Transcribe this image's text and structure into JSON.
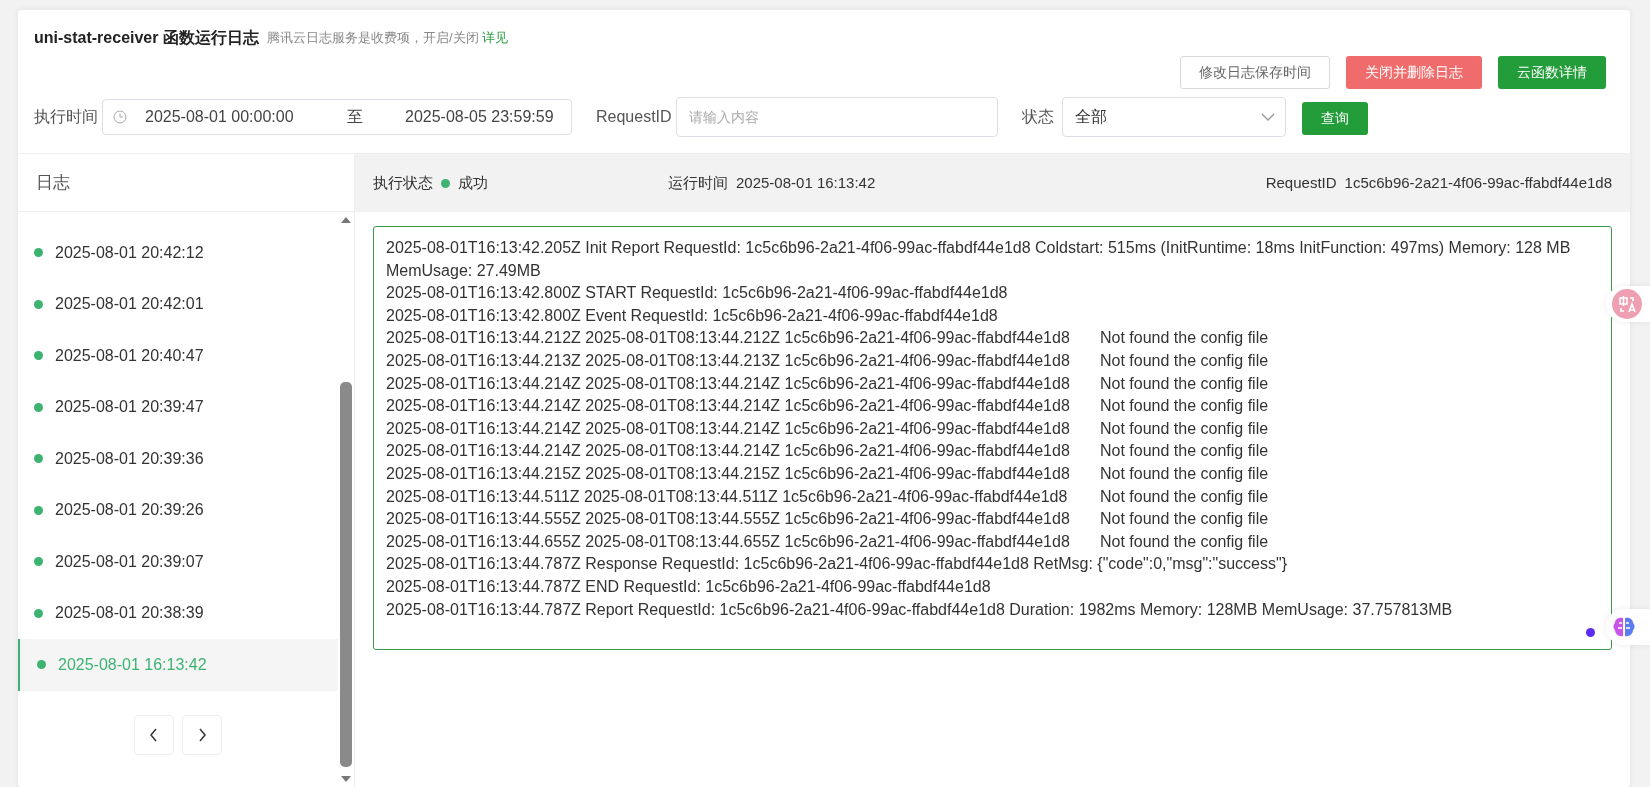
{
  "header": {
    "title": "uni-stat-receiver 函数运行日志",
    "note": "腾讯云日志服务是收费项，开启/关闭",
    "note_link": "详见"
  },
  "actions": [
    {
      "label": "修改日志保存时间",
      "kind": "outline"
    },
    {
      "label": "关闭并删除日志",
      "kind": "danger"
    },
    {
      "label": "云函数详情",
      "kind": "primary"
    }
  ],
  "filters": {
    "time_label": "执行时间",
    "start": "2025-08-01 00:00:00",
    "separator": "至",
    "end": "2025-08-05 23:59:59",
    "request_label": "RequestID",
    "request_placeholder": "请输入内容",
    "status_label": "状态",
    "status_value": "全部",
    "query_button": "查询"
  },
  "sidebar": {
    "title": "日志",
    "items": [
      {
        "time": "2025-08-01 20:42:12",
        "selected": false
      },
      {
        "time": "2025-08-01 20:42:01",
        "selected": false
      },
      {
        "time": "2025-08-01 20:40:47",
        "selected": false
      },
      {
        "time": "2025-08-01 20:39:47",
        "selected": false
      },
      {
        "time": "2025-08-01 20:39:36",
        "selected": false
      },
      {
        "time": "2025-08-01 20:39:26",
        "selected": false
      },
      {
        "time": "2025-08-01 20:39:07",
        "selected": false
      },
      {
        "time": "2025-08-01 20:38:39",
        "selected": false
      },
      {
        "time": "2025-08-01 16:13:42",
        "selected": true
      }
    ]
  },
  "detail": {
    "status_label": "执行状态",
    "status": "成功",
    "runtime_label": "运行时间",
    "runtime": "2025-08-01 16:13:42",
    "request_label": "RequestID",
    "request_id": "1c5c6b96-2a21-4f06-99ac-ffabdf44e1d8",
    "log_lines": [
      "2025-08-01T16:13:42.205Z Init Report RequestId: 1c5c6b96-2a21-4f06-99ac-ffabdf44e1d8 Coldstart: 515ms (InitRuntime: 18ms InitFunction: 497ms) Memory: 128 MB MemUsage: 27.49MB",
      "2025-08-01T16:13:42.800Z START RequestId: 1c5c6b96-2a21-4f06-99ac-ffabdf44e1d8",
      "2025-08-01T16:13:42.800Z Event RequestId: 1c5c6b96-2a21-4f06-99ac-ffabdf44e1d8",
      "2025-08-01T16:13:44.212Z 2025-08-01T08:13:44.212Z 1c5c6b96-2a21-4f06-99ac-ffabdf44e1d8\tNot found the config file",
      "2025-08-01T16:13:44.213Z 2025-08-01T08:13:44.213Z 1c5c6b96-2a21-4f06-99ac-ffabdf44e1d8\tNot found the config file",
      "2025-08-01T16:13:44.214Z 2025-08-01T08:13:44.214Z 1c5c6b96-2a21-4f06-99ac-ffabdf44e1d8\tNot found the config file",
      "2025-08-01T16:13:44.214Z 2025-08-01T08:13:44.214Z 1c5c6b96-2a21-4f06-99ac-ffabdf44e1d8\tNot found the config file",
      "2025-08-01T16:13:44.214Z 2025-08-01T08:13:44.214Z 1c5c6b96-2a21-4f06-99ac-ffabdf44e1d8\tNot found the config file",
      "2025-08-01T16:13:44.214Z 2025-08-01T08:13:44.214Z 1c5c6b96-2a21-4f06-99ac-ffabdf44e1d8\tNot found the config file",
      "2025-08-01T16:13:44.215Z 2025-08-01T08:13:44.215Z 1c5c6b96-2a21-4f06-99ac-ffabdf44e1d8\tNot found the config file",
      "2025-08-01T16:13:44.511Z 2025-08-01T08:13:44.511Z 1c5c6b96-2a21-4f06-99ac-ffabdf44e1d8\tNot found the config file",
      "2025-08-01T16:13:44.555Z 2025-08-01T08:13:44.555Z 1c5c6b96-2a21-4f06-99ac-ffabdf44e1d8\tNot found the config file",
      "2025-08-01T16:13:44.655Z 2025-08-01T08:13:44.655Z 1c5c6b96-2a21-4f06-99ac-ffabdf44e1d8\tNot found the config file",
      "2025-08-01T16:13:44.787Z Response RequestId: 1c5c6b96-2a21-4f06-99ac-ffabdf44e1d8 RetMsg: {\"code\":0,\"msg\":\"success\"}",
      "2025-08-01T16:13:44.787Z END RequestId: 1c5c6b96-2a21-4f06-99ac-ffabdf44e1d8",
      "2025-08-01T16:13:44.787Z Report RequestId: 1c5c6b96-2a21-4f06-99ac-ffabdf44e1d8 Duration: 1982ms Memory: 128MB MemUsage: 37.757813MB"
    ]
  }
}
